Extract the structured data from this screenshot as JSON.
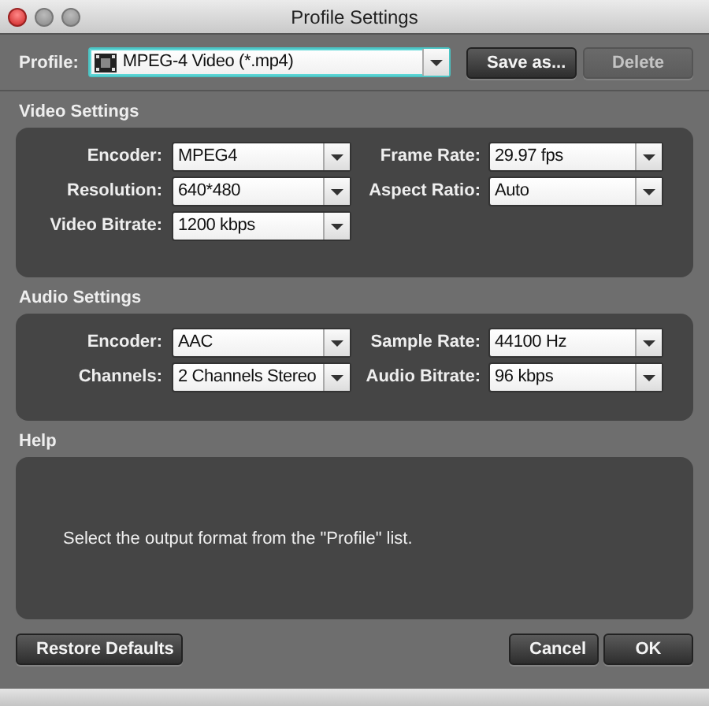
{
  "window": {
    "title": "Profile Settings"
  },
  "profile": {
    "label": "Profile:",
    "value": "MPEG-4 Video (*.mp4)"
  },
  "toolbar_buttons": [
    {
      "label": "Save as...",
      "disabled": false
    },
    {
      "label": "Delete",
      "disabled": true
    }
  ],
  "sections": [
    {
      "title": "Video Settings",
      "fields": [
        {
          "label": "Encoder:",
          "value": "MPEG4"
        },
        {
          "label": "Frame Rate:",
          "value": "29.97 fps"
        },
        {
          "label": "Resolution:",
          "value": "640*480"
        },
        {
          "label": "Aspect Ratio:",
          "value": "Auto"
        },
        {
          "label": "Video Bitrate:",
          "value": "1200 kbps"
        }
      ]
    },
    {
      "title": "Audio Settings",
      "fields": [
        {
          "label": "Encoder:",
          "value": "AAC"
        },
        {
          "label": "Sample Rate:",
          "value": "44100 Hz"
        },
        {
          "label": "Channels:",
          "value": "2 Channels Stereo"
        },
        {
          "label": "Audio Bitrate:",
          "value": "96 kbps"
        }
      ]
    }
  ],
  "help": {
    "title": "Help",
    "text": "Select the output format from the \"Profile\" list."
  },
  "footer": {
    "left_buttons": [
      "Restore Defaults"
    ],
    "right_buttons": [
      "Cancel",
      "OK"
    ]
  }
}
